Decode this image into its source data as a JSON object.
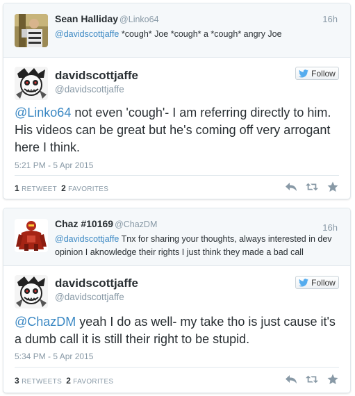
{
  "tweets": [
    {
      "parent": {
        "name": "Sean Halliday",
        "handle": "@Linko64",
        "time": "16h",
        "mention": "@davidscottjaffe",
        "text": " *cough* Joe *cough* a *cough* angry Joe"
      },
      "main": {
        "name": "davidscottjaffe",
        "handle": "@davidscottjaffe",
        "follow_label": "Follow",
        "mention": "@Linko64",
        "text": " not even 'cough'- I am referring directly to him. His videos can be great but he's coming off very arrogant here I think.",
        "timestamp": "5:21 PM - 5 Apr 2015",
        "retweets_count": "1",
        "retweets_label": "RETWEET",
        "favorites_count": "2",
        "favorites_label": "FAVORITES"
      }
    },
    {
      "parent": {
        "name": "Chaz #10169",
        "handle": "@ChazDM",
        "time": "16h",
        "mention": "@davidscottjaffe",
        "text": " Tnx for sharing your thoughts, always interested in dev opinion I aknowledge their rights I just think they made a bad call"
      },
      "main": {
        "name": "davidscottjaffe",
        "handle": "@davidscottjaffe",
        "follow_label": "Follow",
        "mention": "@ChazDM",
        "text": " yeah I do as well- my take tho is just cause it's a dumb call it is still their right to be stupid.",
        "timestamp": "5:34 PM - 5 Apr 2015",
        "retweets_count": "3",
        "retweets_label": "RETWEETS",
        "favorites_count": "2",
        "favorites_label": "FAVORITES"
      }
    }
  ],
  "colors": {
    "link": "#3b88c3",
    "muted": "#8899a6",
    "text": "#292f33",
    "twitter_bird": "#55acee"
  },
  "icons": [
    "reply-icon",
    "retweet-icon",
    "favorite-icon",
    "twitter-bird-icon"
  ]
}
